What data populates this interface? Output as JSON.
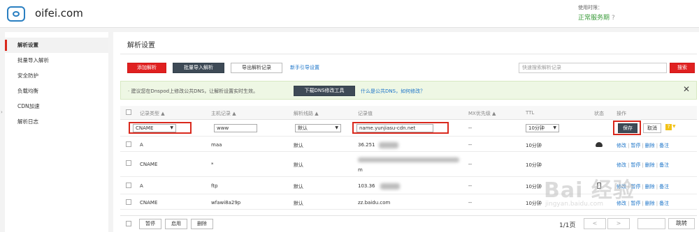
{
  "header": {
    "brand": "oifei.com",
    "service_label": "使用时限：",
    "service_value": "正常服务期",
    "service_help": "?"
  },
  "sidebar": {
    "items": [
      {
        "label": "解析设置",
        "active": true
      },
      {
        "label": "批量导入解析"
      },
      {
        "label": "安全防护"
      },
      {
        "label": "负载均衡"
      },
      {
        "label": "CDN加速"
      },
      {
        "label": "解析日志"
      }
    ],
    "collapse_arrow": "›"
  },
  "page": {
    "title": "解析设置"
  },
  "toolbar": {
    "add": "添加解析",
    "batch_import": "批量导入解析",
    "export": "导出解析记录",
    "guide": "新手引导设置",
    "search_placeholder": "快速搜索解析记录",
    "search_button": "搜索"
  },
  "notice": {
    "text": "· 建议您在Dnspod上修改公共DNS，让解析设置实时生效。",
    "download_button": "下载DNS修改工具",
    "help_link": "什么是公共DNS，如何修改？",
    "close": "✕"
  },
  "table": {
    "headers": {
      "type": "记录类型 ▲",
      "host": "主机记录 ▲",
      "line": "解析线路 ▲",
      "value": "记录值",
      "mx": "MX优先级 ▲",
      "ttl": "TTL",
      "status": "状态",
      "ops": "操作"
    },
    "edit_row": {
      "type": "CNAME",
      "host": "www",
      "line": "默认",
      "value": "name.yunjiasu-cdn.net",
      "mx": "--",
      "ttl": "10分钟",
      "save": "保存",
      "cancel": "取消",
      "help": "?"
    },
    "rows": [
      {
        "type": "A",
        "host": "maa",
        "line": "默认",
        "value": "36.251",
        "mx": "--",
        "ttl": "10分钟"
      },
      {
        "type": "CNAME",
        "host": "*",
        "line": "默认",
        "value": "m",
        "mx": "--",
        "ttl": "10分钟"
      },
      {
        "type": "A",
        "host": "ftp",
        "line": "默认",
        "value": "103.36",
        "mx": "--",
        "ttl": "10分钟"
      },
      {
        "type": "CNAME",
        "host": "wfawi8a29p",
        "line": "默认",
        "value": "zz.baidu.com",
        "mx": "--",
        "ttl": "10分钟"
      }
    ],
    "row_ops": {
      "edit": "修改",
      "pause": "暂停",
      "delete": "删除",
      "note": "备注",
      "sep": "|"
    }
  },
  "footer": {
    "pause": "暂停",
    "enable": "启用",
    "delete": "删除",
    "page_info": "1/1页",
    "prev": "<",
    "next": ">",
    "jump": "跳转"
  },
  "watermark": {
    "text": "Bai 经验",
    "sub": "jingyan.baidu.com"
  },
  "colors": {
    "accent_red": "#e02020",
    "link_blue": "#1a73c8",
    "service_green": "#3a9b3a",
    "dark_button": "#3e4a56"
  }
}
